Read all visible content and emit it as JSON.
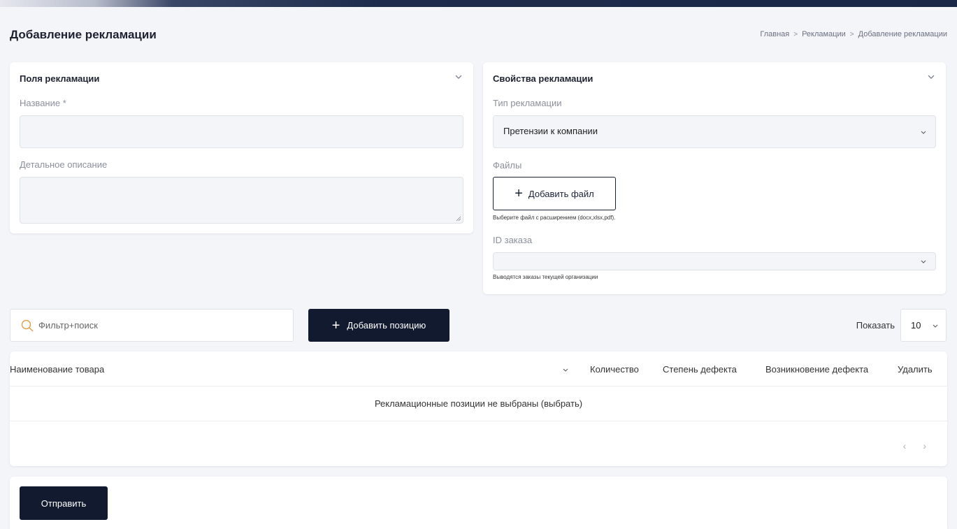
{
  "header": {
    "title": "Добавление рекламации",
    "breadcrumb": [
      "Главная",
      "Рекламации",
      "Добавление рекламации"
    ]
  },
  "fields_card": {
    "title": "Поля рекламации",
    "name_label": "Название *",
    "name_value": "",
    "description_label": "Детальное описание",
    "description_value": ""
  },
  "props_card": {
    "title": "Свойства рекламации",
    "type_label": "Тип рекламации",
    "type_selected": "Претензии к компании",
    "files_label": "Файлы",
    "add_file_label": "Добавить файл",
    "files_hint": "Выберите файл с расширением (docx,xlsx,pdf).",
    "order_label": "ID заказа",
    "order_selected": "",
    "order_hint": "Выводятся заказы текущей организации"
  },
  "toolbar": {
    "search_placeholder": "Фильтр+поиск",
    "add_position_label": "Добавить позицию",
    "show_label": "Показать",
    "page_size": "10"
  },
  "table": {
    "columns": [
      "Наименование товара",
      "Количество",
      "Степень дефекта",
      "Возникновение дефекта",
      "Удалить"
    ],
    "empty_text": "Рекламационные позиции не выбраны (выбрать)",
    "prev": "‹",
    "next": "›"
  },
  "footer": {
    "submit_label": "Отправить"
  },
  "colors": {
    "primary": "#111a2e",
    "background": "#f3f5f9",
    "search_icon": "#e0a04a"
  }
}
